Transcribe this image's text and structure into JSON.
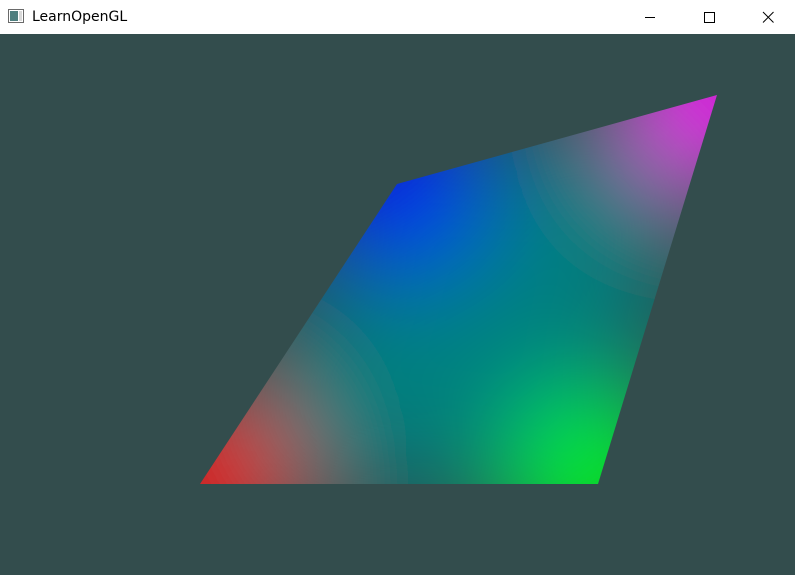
{
  "window": {
    "title": "LearnOpenGL",
    "icon": "app-window-icon",
    "controls": {
      "minimize": "minimize-icon",
      "maximize": "maximize-icon",
      "close": "close-icon"
    }
  },
  "viewport": {
    "clear_color": "#334d4d",
    "shape": "quad",
    "vertex_colors": {
      "top_left": "#0000ff",
      "top_right": "#ff00ff",
      "bottom_left": "#ff0000",
      "bottom_right": "#00ff00"
    }
  }
}
